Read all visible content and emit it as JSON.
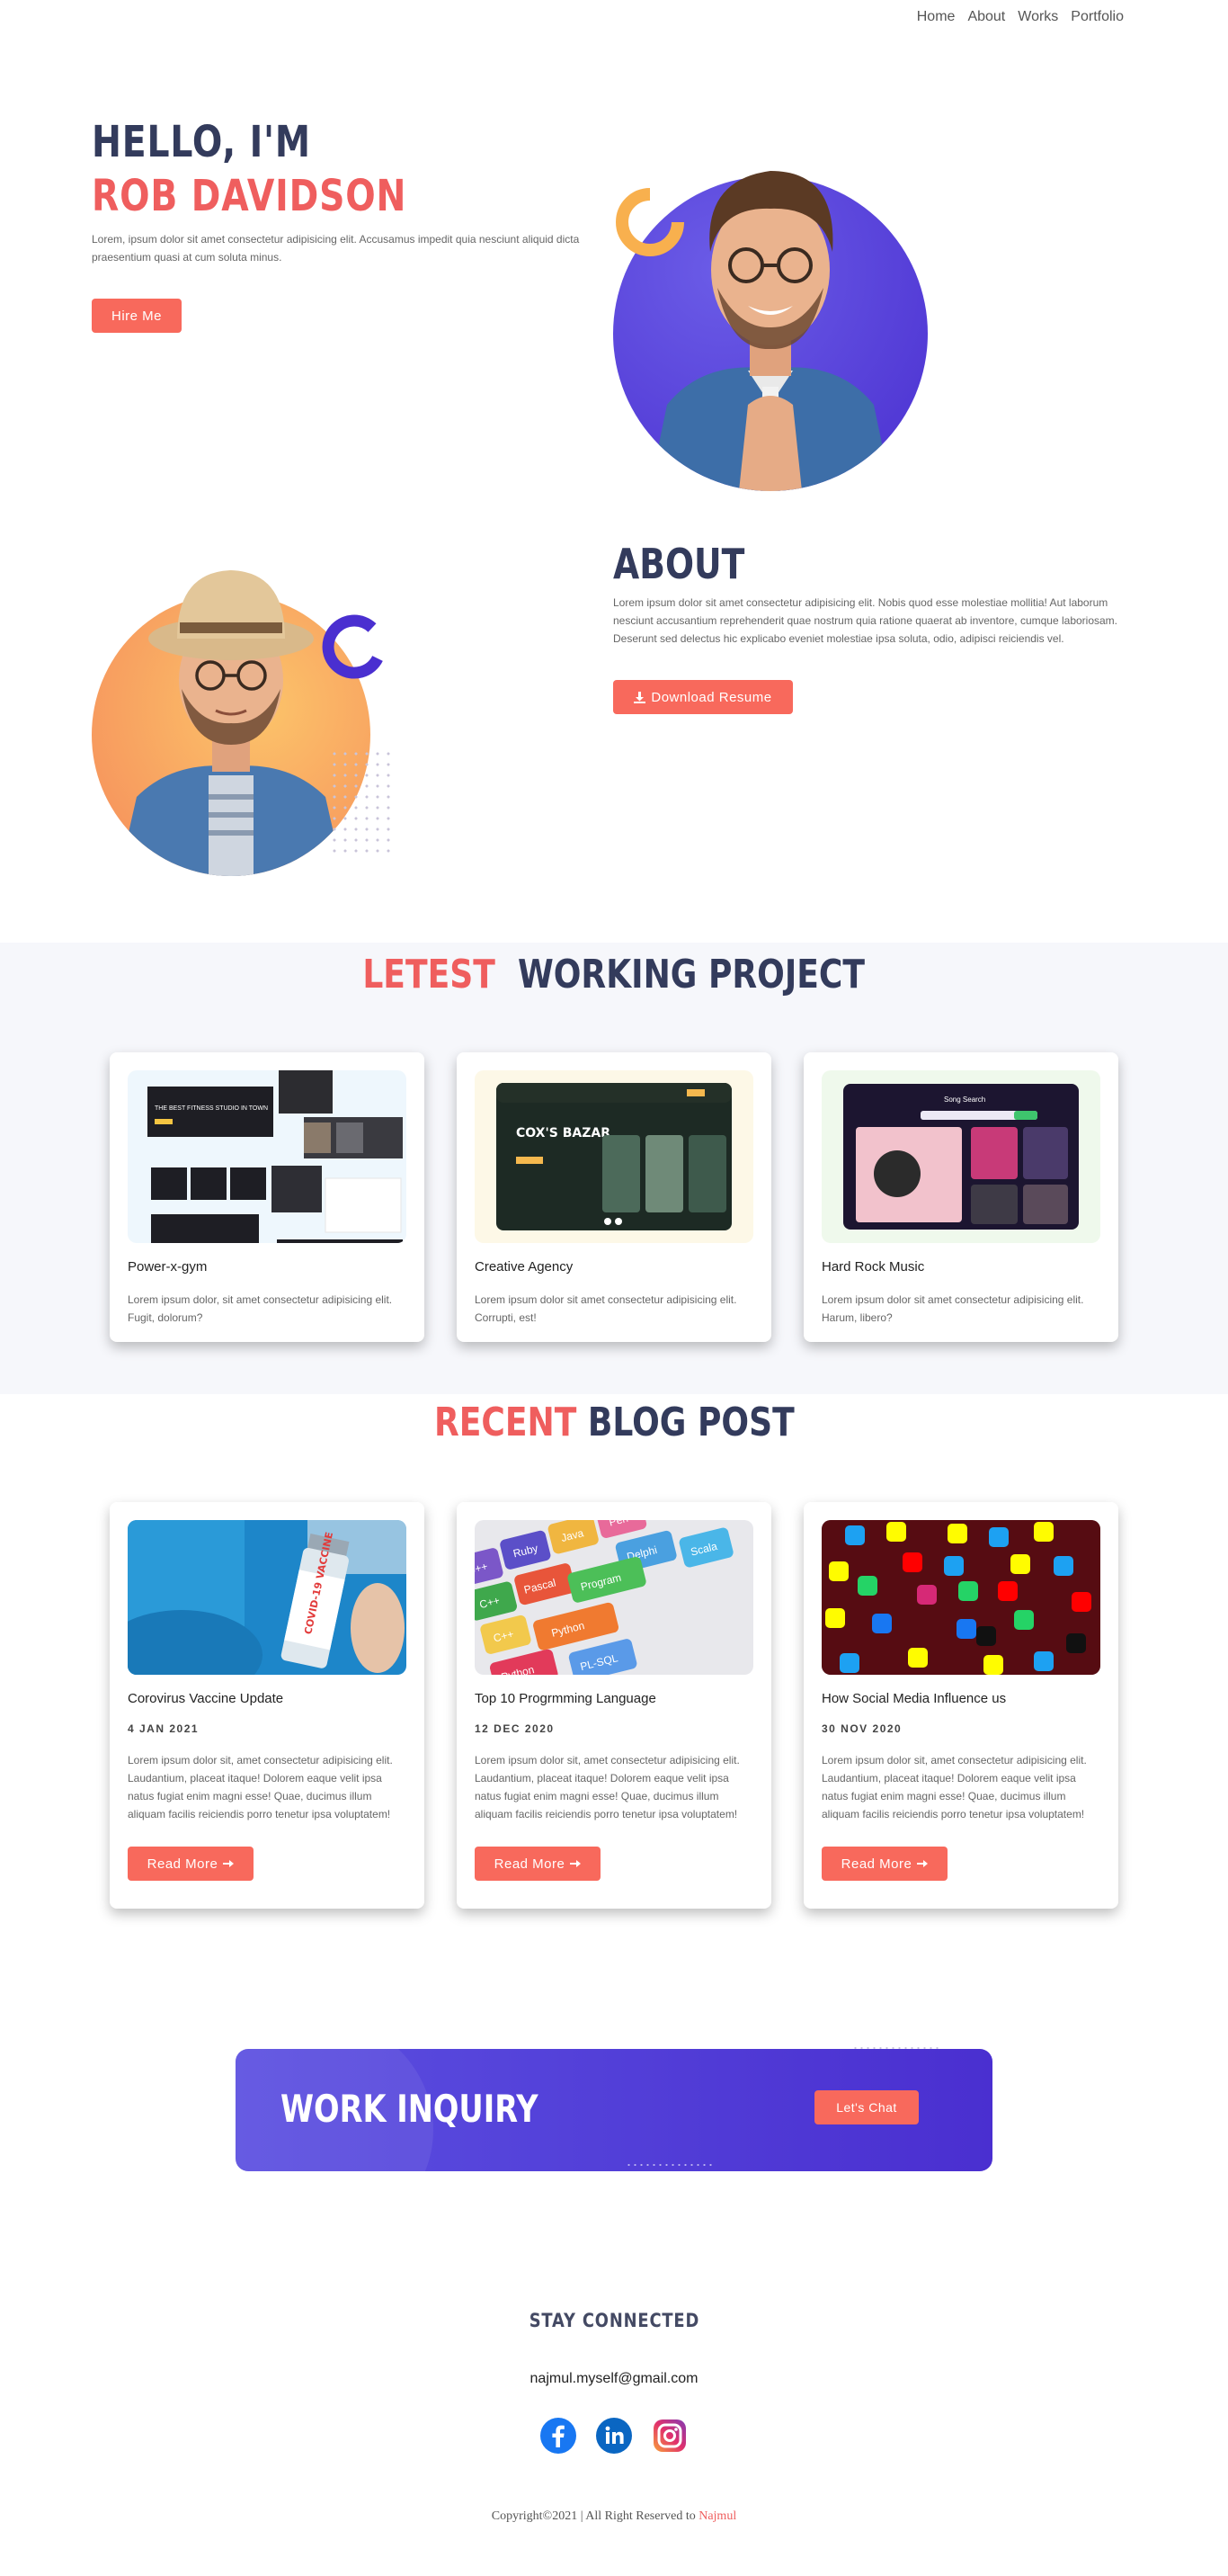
{
  "nav": {
    "items": [
      "Home",
      "About",
      "Works",
      "Portfolio"
    ]
  },
  "hero": {
    "greeting": "HELLO, I'M",
    "name": "ROB DAVIDSON",
    "text": "Lorem, ipsum dolor sit amet consectetur adipisicing elit. Accusamus impedit quia nesciunt aliquid dicta praesentium quasi at cum soluta minus.",
    "button": "Hire Me"
  },
  "about": {
    "title": "ABOUT",
    "text": "Lorem ipsum dolor sit amet consectetur adipisicing elit. Nobis quod esse molestiae mollitia! Aut laborum nesciunt accusantium reprehenderit quae nostrum quia ratione quaerat ab inventore, cumque laboriosam. Deserunt sed delectus hic explicabo eveniet molestiae ipsa soluta, odio, adipisci reiciendis vel.",
    "button": "Download Resume"
  },
  "projects": {
    "title_accent": "LETEST",
    "title_main": "WORKING PROJECT",
    "items": [
      {
        "name": "Power-x-gym",
        "text": "Lorem ipsum dolor, sit amet consectetur adipisicing elit. Fugit, dolorum?",
        "thumb_caption": "THE BEST FITNESS STUDIO IN TOWN"
      },
      {
        "name": "Creative Agency",
        "text": "Lorem ipsum dolor sit amet consectetur adipisicing elit. Corrupti, est!",
        "thumb_caption": "COX'S BAZAR"
      },
      {
        "name": "Hard Rock Music",
        "text": "Lorem ipsum dolor sit amet consectetur adipisicing elit. Harum, libero?",
        "thumb_caption": "Song Search"
      }
    ]
  },
  "blog": {
    "title_accent": "RECENT",
    "title_main": "BLOG POST",
    "read_more": "Read More",
    "items": [
      {
        "title": "Corovirus Vaccine Update",
        "date": "4 JAN 2021",
        "text": "Lorem ipsum dolor sit, amet consectetur adipisicing elit. Laudantium, placeat itaque! Dolorem eaque velit ipsa natus fugiat enim magni esse! Quae, ducimus illum aliquam facilis reiciendis porro tenetur ipsa voluptatem!",
        "image_label": "COVID-19 VACCINE"
      },
      {
        "title": "Top 10 Progrmming Language",
        "date": "12 DEC 2020",
        "text": "Lorem ipsum dolor sit, amet consectetur adipisicing elit. Laudantium, placeat itaque! Dolorem eaque velit ipsa natus fugiat enim magni esse! Quae, ducimus illum aliquam facilis reiciendis porro tenetur ipsa voluptatem!",
        "image_keys": [
          "C++",
          "Ruby",
          "Java",
          "Perl",
          "C++",
          "Pascal",
          "Delphi",
          "Program",
          "C++",
          "Python",
          "Python",
          "PL-SQL",
          "Scala"
        ]
      },
      {
        "title": "How Social Media Influence us",
        "date": "30 NOV 2020",
        "text": "Lorem ipsum dolor sit, amet consectetur adipisicing elit. Laudantium, placeat itaque! Dolorem eaque velit ipsa natus fugiat enim magni esse! Quae, ducimus illum aliquam facilis reiciendis porro tenetur ipsa voluptatem!"
      }
    ]
  },
  "inquiry": {
    "title": "WORK INQUIRY",
    "button": "Let's Chat"
  },
  "footer": {
    "heading": "STAY CONNECTED",
    "email": "najmul.myself@gmail.com",
    "socials": [
      "facebook",
      "linkedin",
      "instagram"
    ],
    "copyright": "Copyright©2021 | All Right Reserved to ",
    "owner": "Najmul"
  },
  "colors": {
    "accent": "#ef5e5e",
    "button": "#f8695c",
    "navy": "#333b5c",
    "purple": "#4a2fd0"
  },
  "icons": {
    "download": "download-icon",
    "arrow": "arrow-right-icon"
  }
}
